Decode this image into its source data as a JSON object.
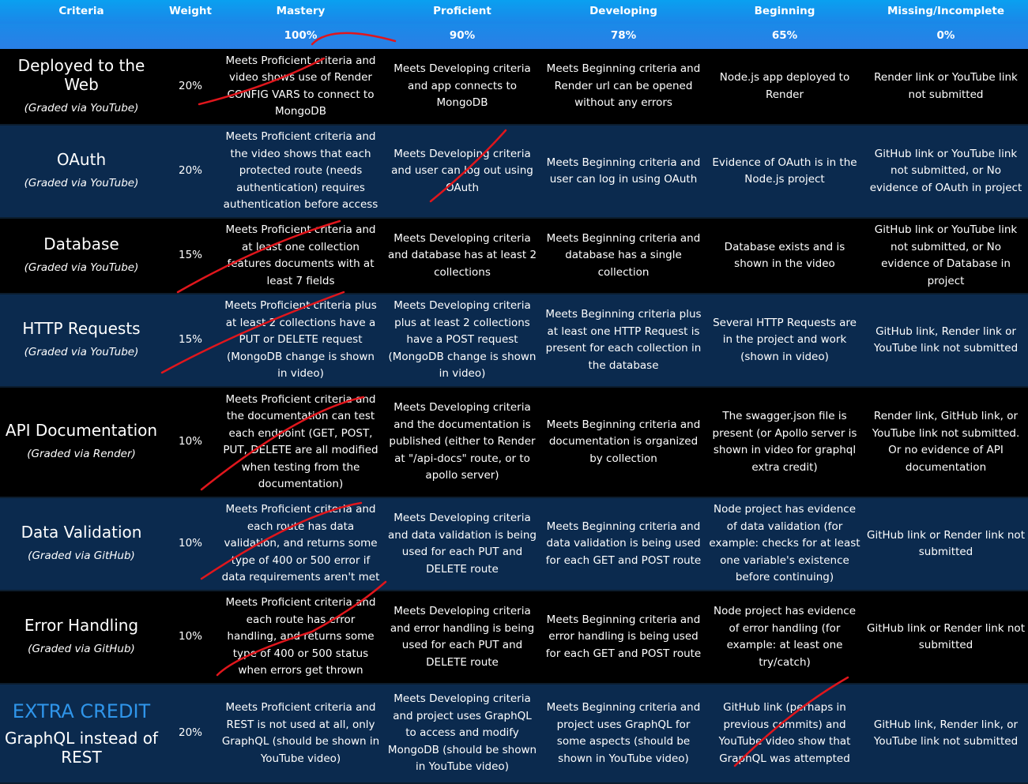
{
  "headers": {
    "criteria": "Criteria",
    "weight": "Weight",
    "mastery": "Mastery",
    "proficient": "Proficient",
    "developing": "Developing",
    "beginning": "Beginning",
    "missing": "Missing/Incomplete"
  },
  "percentages": {
    "mastery": "100%",
    "proficient": "90%",
    "developing": "78%",
    "beginning": "65%",
    "missing": "0%"
  },
  "rows": [
    {
      "name": "Deployed to the Web",
      "graded": "(Graded via YouTube)",
      "weight": "20%",
      "mastery": "Meets Proficient criteria and video shows use of Render CONFIG VARS to connect to MongoDB",
      "proficient": "Meets Developing criteria and app connects to MongoDB",
      "developing": "Meets Beginning criteria and Render url can be opened without any errors",
      "beginning": "Node.js app deployed to Render",
      "missing": "Render link or YouTube link not submitted"
    },
    {
      "name": "OAuth",
      "graded": "(Graded via YouTube)",
      "weight": "20%",
      "mastery": "Meets Proficient criteria and the video shows that each protected route (needs authentication) requires authentication before access",
      "proficient": "Meets Developing criteria and user can log out using OAuth",
      "developing": "Meets Beginning criteria and user can log in using OAuth",
      "beginning": "Evidence of OAuth is in the Node.js project",
      "missing": "GitHub link or YouTube link not submitted, or No evidence of OAuth in project"
    },
    {
      "name": "Database",
      "graded": "(Graded via YouTube)",
      "weight": "15%",
      "mastery": "Meets Proficient criteria and at least one collection features documents with at least 7 fields",
      "proficient": "Meets Developing criteria and database has at least 2 collections",
      "developing": "Meets Beginning criteria and database has a single collection",
      "beginning": "Database exists and is shown in the video",
      "missing": "GitHub link or YouTube link not submitted, or No evidence of Database in project"
    },
    {
      "name": "HTTP Requests",
      "graded": "(Graded via YouTube)",
      "weight": "15%",
      "mastery": "Meets Proficient criteria plus at least 2 collections have a PUT or DELETE request (MongoDB change is shown in video)",
      "proficient": "Meets Developing criteria plus at least 2 collections have a POST request (MongoDB change is shown in video)",
      "developing": "Meets Beginning criteria plus at least one HTTP Request is present for each collection in the database",
      "beginning": "Several HTTP Requests are in the project and work (shown in video)",
      "missing": "GitHub link, Render link or YouTube link not submitted"
    },
    {
      "name": "API Documentation",
      "graded": "(Graded via Render)",
      "weight": "10%",
      "mastery": "Meets Proficient criteria and the documentation can test each endpoint (GET, POST, PUT, DELETE are all modified when testing from the documentation)",
      "proficient": "Meets Developing criteria and the documentation is published (either to Render at \"/api-docs\" route, or to apollo server)",
      "developing": "Meets Beginning criteria and documentation is organized by collection",
      "beginning": "The swagger.json file is present (or Apollo server is shown in video for graphql extra credit)",
      "missing": "Render link, GitHub link, or YouTube link not submitted. Or no evidence of API documentation"
    },
    {
      "name": "Data Validation",
      "graded": "(Graded via GitHub)",
      "weight": "10%",
      "mastery": "Meets Proficient criteria and each route has data validation, and returns some type of 400 or 500 error if data requirements aren't met",
      "proficient": "Meets Developing criteria and data validation is being used for each PUT and DELETE route",
      "developing": "Meets Beginning criteria and data validation is being used for each GET and POST route",
      "beginning": "Node project has evidence of data validation (for example: checks for at least one variable's existence before continuing)",
      "missing": "GitHub link or Render link not submitted"
    },
    {
      "name": "Error Handling",
      "graded": "(Graded via GitHub)",
      "weight": "10%",
      "mastery": "Meets Proficient criteria and each route has error handling, and returns some type of 400 or 500 status when errors get thrown",
      "proficient": "Meets Developing criteria and error handling is being used for each PUT and DELETE route",
      "developing": "Meets Beginning criteria and error handling is being used for each GET and POST route",
      "beginning": "Node project has evidence of error handling (for example: at least one try/catch)",
      "missing": "GitHub link or Render link not submitted"
    }
  ],
  "extra": {
    "label": "EXTRA CREDIT",
    "name": "GraphQL instead of REST",
    "weight": "20%",
    "mastery": "Meets Proficient criteria and REST is not used at all, only GraphQL (should be shown in YouTube video)",
    "proficient": "Meets Developing criteria and project uses GraphQL to access and modify MongoDB (should be shown in YouTube video)",
    "developing": "Meets Beginning criteria and project uses GraphQL for some aspects (should be shown in YouTube video)",
    "beginning": "GitHub link (perhaps in previous commits) and YouTube video show that GraphQL was attempted",
    "missing": "GitHub link, Render link, or YouTube link not submitted"
  },
  "colors": {
    "header": "#1b86e8",
    "row_blue": "#0b2a4e",
    "row_dark": "#000000",
    "extra_label": "#2f95ea",
    "annotation": "#e0161c"
  }
}
